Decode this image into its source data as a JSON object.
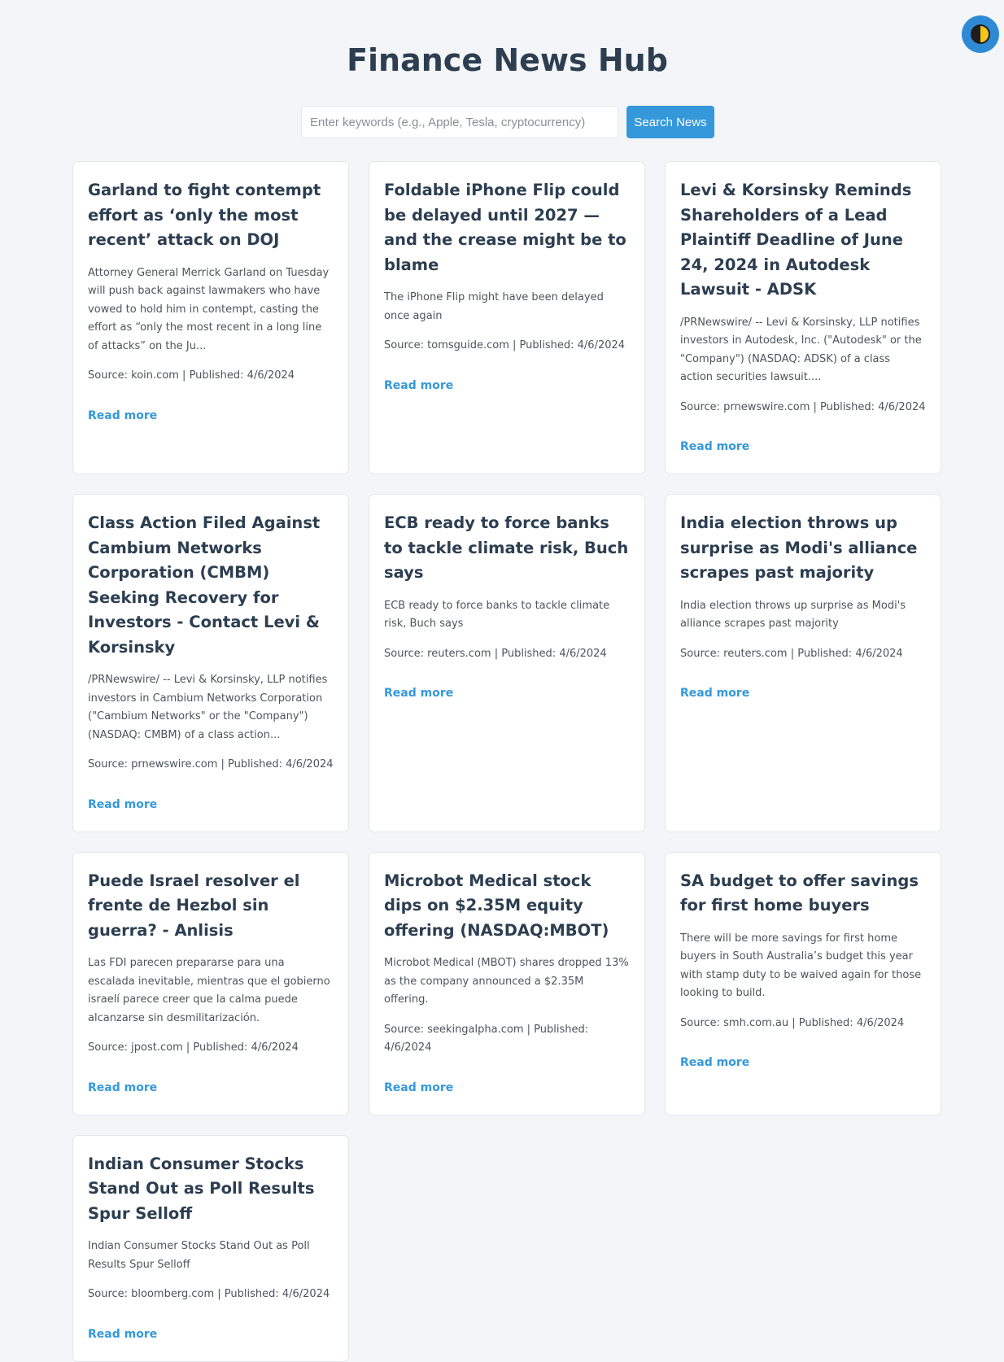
{
  "app": {
    "title": "Finance News Hub",
    "theme_toggle_icon": "half-moon-icon"
  },
  "search": {
    "placeholder": "Enter keywords (e.g., Apple, Tesla, cryptocurrency)",
    "value": "",
    "button_label": "Search News"
  },
  "colors": {
    "accent": "#3498db",
    "heading": "#2c3e50",
    "background": "#f3f5f8",
    "toggle_bg": "#2f8ad6"
  },
  "articles": [
    {
      "title": "Garland to fight contempt effort as ‘only the most recent’ attack on DOJ",
      "description": "Attorney General Merrick Garland on Tuesday will push back against lawmakers who have vowed to hold him in contempt, casting the effort as “only the most recent in a long line of attacks” on the Ju...",
      "meta": "Source: koin.com | Published: 4/6/2024",
      "link_label": "Read more"
    },
    {
      "title": "Foldable iPhone Flip could be delayed until 2027 — and the crease might be to blame",
      "description": "The iPhone Flip might have been delayed once again",
      "meta": "Source: tomsguide.com | Published: 4/6/2024",
      "link_label": "Read more"
    },
    {
      "title": "Levi & Korsinsky Reminds Shareholders of a Lead Plaintiff Deadline of June 24, 2024 in Autodesk Lawsuit - ADSK",
      "description": "/PRNewswire/ -- Levi & Korsinsky, LLP notifies investors in Autodesk, Inc. (\"Autodesk\" or the \"Company\") (NASDAQ: ADSK) of a class action securities lawsuit....",
      "meta": "Source: prnewswire.com | Published: 4/6/2024",
      "link_label": "Read more"
    },
    {
      "title": "Class Action Filed Against Cambium Networks Corporation (CMBM) Seeking Recovery for Investors - Contact Levi & Korsinsky",
      "description": "/PRNewswire/ -- Levi & Korsinsky, LLP notifies investors in Cambium Networks Corporation (\"Cambium Networks\" or the \"Company\") (NASDAQ: CMBM) of a class action...",
      "meta": "Source: prnewswire.com | Published: 4/6/2024",
      "link_label": "Read more"
    },
    {
      "title": "ECB ready to force banks to tackle climate risk, Buch says",
      "description": "ECB ready to force banks to tackle climate risk, Buch says",
      "meta": "Source: reuters.com | Published: 4/6/2024",
      "link_label": "Read more"
    },
    {
      "title": "India election throws up surprise as Modi's alliance scrapes past majority",
      "description": "India election throws up surprise as Modi's alliance scrapes past majority",
      "meta": "Source: reuters.com | Published: 4/6/2024",
      "link_label": "Read more"
    },
    {
      "title": "Puede Israel resolver el frente de Hezbol sin guerra? - Anlisis",
      "description": "Las FDI parecen prepararse para una escalada inevitable, mientras que el gobierno israelí parece creer que la calma puede alcanzarse sin desmilitarización.",
      "meta": "Source: jpost.com | Published: 4/6/2024",
      "link_label": "Read more"
    },
    {
      "title": "Microbot Medical stock dips on $2.35M equity offering (NASDAQ:MBOT)",
      "description": "Microbot Medical (MBOT) shares dropped 13% as the company announced a $2.35M offering.",
      "meta": "Source: seekingalpha.com | Published: 4/6/2024",
      "link_label": "Read more"
    },
    {
      "title": "SA budget to offer savings for first home buyers",
      "description": "There will be more savings for first home buyers in South Australia’s budget this year with stamp duty to be waived again for those looking to build.",
      "meta": "Source: smh.com.au | Published: 4/6/2024",
      "link_label": "Read more"
    },
    {
      "title": "Indian Consumer Stocks Stand Out as Poll Results Spur Selloff",
      "description": "Indian Consumer Stocks Stand Out as Poll Results Spur Selloff",
      "meta": "Source: bloomberg.com | Published: 4/6/2024",
      "link_label": "Read more"
    }
  ]
}
